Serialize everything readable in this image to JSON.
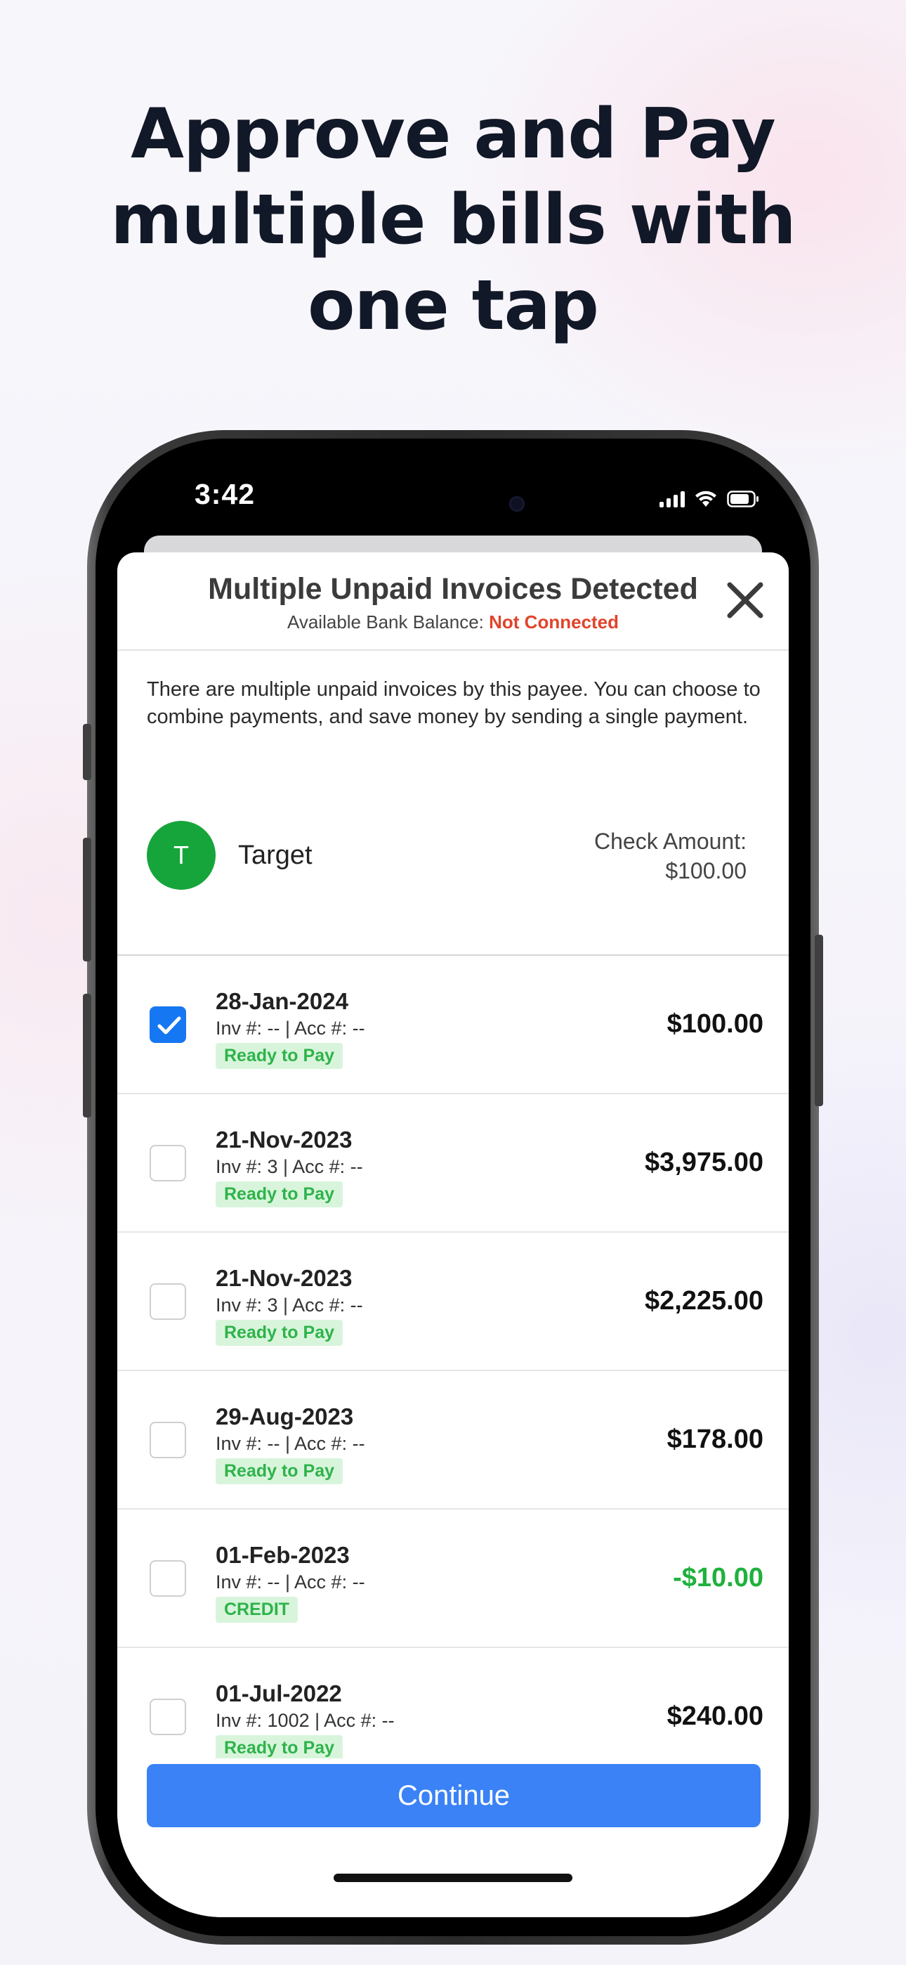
{
  "headline": {
    "line1": "Approve and Pay",
    "line2": "multiple bills with",
    "line3": "one tap"
  },
  "status_bar": {
    "time": "3:42"
  },
  "sheet": {
    "title": "Multiple Unpaid Invoices Detected",
    "balance_label": "Available Bank Balance:",
    "balance_value": "Not Connected",
    "intro": "There are multiple unpaid invoices by this payee. You can choose to combine payments, and save money by sending a single payment."
  },
  "payee": {
    "initial": "T",
    "name": "Target",
    "check_label": "Check Amount:",
    "check_amount": "$100.00"
  },
  "invoices": [
    {
      "date": "28-Jan-2024",
      "inv": "Inv #: -- | Acc #: --",
      "badge": "Ready to Pay",
      "amount": "$100.00",
      "checked": true
    },
    {
      "date": "21-Nov-2023",
      "inv": "Inv #: 3 | Acc #: --",
      "badge": "Ready to Pay",
      "amount": "$3,975.00",
      "checked": false
    },
    {
      "date": "21-Nov-2023",
      "inv": "Inv #: 3 | Acc #: --",
      "badge": "Ready to Pay",
      "amount": "$2,225.00",
      "checked": false
    },
    {
      "date": "29-Aug-2023",
      "inv": "Inv #: -- | Acc #: --",
      "badge": "Ready to Pay",
      "amount": "$178.00",
      "checked": false
    },
    {
      "date": "01-Feb-2023",
      "inv": "Inv #: -- | Acc #: --",
      "badge": "CREDIT",
      "amount": "-$10.00",
      "checked": false
    },
    {
      "date": "01-Jul-2022",
      "inv": "Inv #: 1002 | Acc #: --",
      "badge": "Ready to Pay",
      "amount": "$240.00",
      "checked": false
    }
  ],
  "continue_label": "Continue",
  "colors": {
    "accent": "#3a82f6",
    "checkbox_checked": "#1677f2",
    "payee_avatar": "#16a53a",
    "not_connected": "#e0442b",
    "credit": "#1fb13c",
    "badge_bg": "#d8f5dc"
  }
}
